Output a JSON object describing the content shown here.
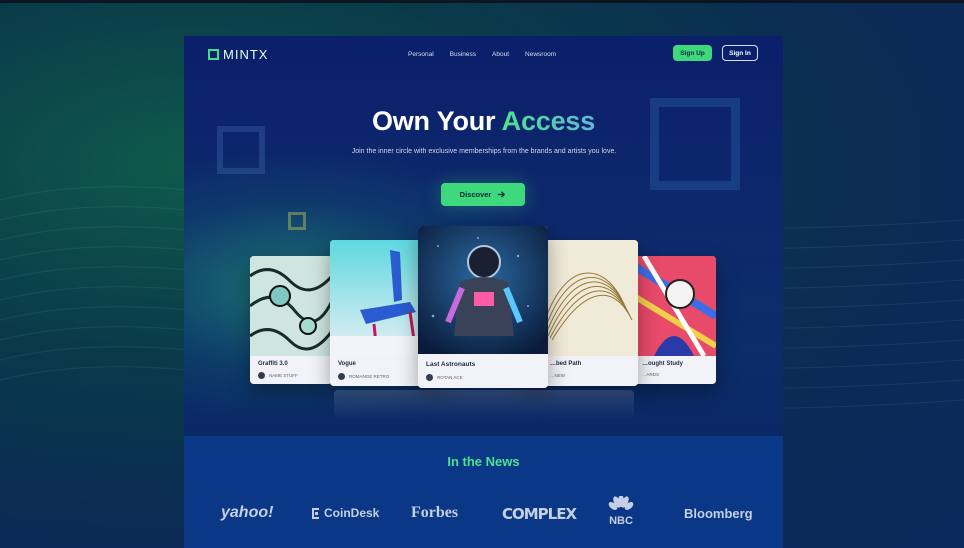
{
  "nav": {
    "logo": "MINTX",
    "links": [
      "Personal",
      "Business",
      "About",
      "Newsroom"
    ],
    "signup_label": "Sign Up",
    "signin_label": "Sign In"
  },
  "hero": {
    "title_main": "Own Your",
    "title_accent": "Access",
    "subtitle": "Join the inner circle with exclusive memberships from the brands and artists you love.",
    "cta_label": "Discover",
    "cta_icon": "arrow-right-icon"
  },
  "cards": [
    {
      "title": "Graffiti 3.0",
      "owner": "NAME STUFF"
    },
    {
      "title": "Vogue",
      "owner": "ROMANGE RETRO"
    },
    {
      "title": "Last Astronauts",
      "owner": "ROTAN ACE"
    },
    {
      "title": "…bed Path",
      "owner": "…NEW"
    },
    {
      "title": "…ought Study",
      "owner": "…ARDS"
    }
  ],
  "news": {
    "title": "In the News",
    "brands": [
      "yahoo!",
      "CoinDesk",
      "Forbes",
      "COMPLEX",
      "NBC",
      "Bloomberg"
    ]
  },
  "colors": {
    "accent": "#3ed97d",
    "page_bg": "#0b1f6a",
    "news_bg": "#0a3886"
  }
}
